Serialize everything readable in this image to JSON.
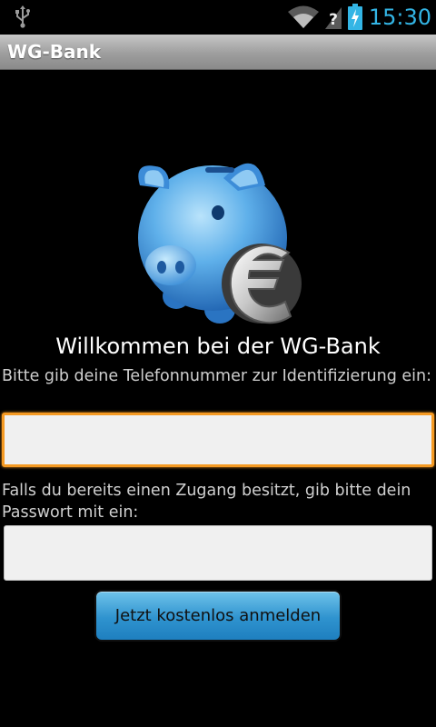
{
  "status_bar": {
    "time": "15:30",
    "icons": [
      "usb-icon",
      "wifi-icon",
      "signal-unknown-icon",
      "battery-charging-icon"
    ],
    "clock_color": "#33b5e5"
  },
  "app": {
    "title": "WG-Bank",
    "logo": "piggy-bank-euro-icon"
  },
  "main": {
    "welcome": "Willkommen bei der WG-Bank",
    "phone_prompt": "Bitte gib deine Telefonnummer zur Identifizierung ein:",
    "phone_value": "",
    "password_prompt": "Falls du bereits einen Zugang besitzt, gib bitte dein Passwort mit ein:",
    "password_value": "",
    "register_button": "Jetzt kostenlos anmelden"
  },
  "colors": {
    "focus_border": "#f59a23",
    "button_blue": "#2f93cf",
    "background": "#000000"
  }
}
